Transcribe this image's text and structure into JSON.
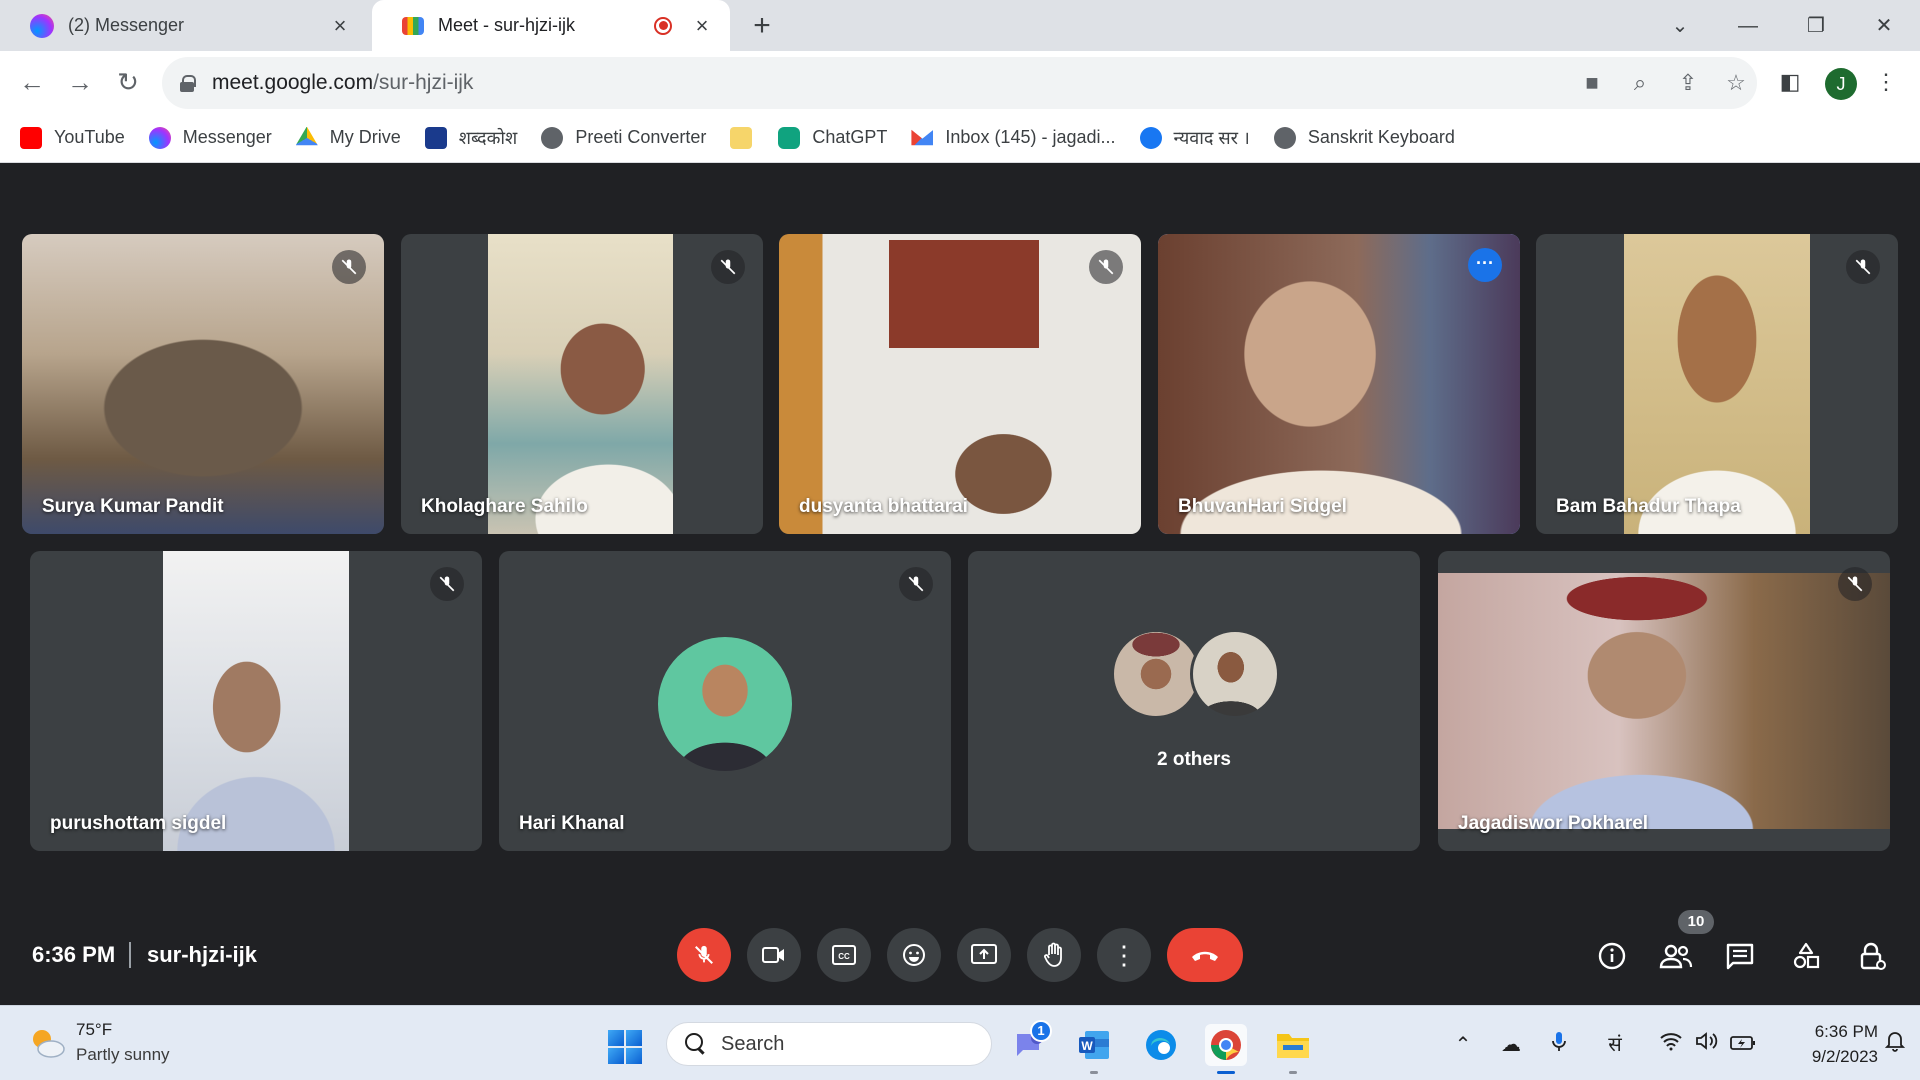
{
  "browser": {
    "tabs": [
      {
        "title": "(2) Messenger"
      },
      {
        "title": "Meet - sur-hjzi-ijk"
      }
    ],
    "url": {
      "host": "meet.google.com",
      "path": "/sur-hjzi-ijk"
    },
    "profile_initial": "J",
    "bookmarks": [
      {
        "label": "YouTube",
        "color": "#ff0000"
      },
      {
        "label": "Messenger",
        "color": "#a334fa"
      },
      {
        "label": "My Drive",
        "color": "#1fa463"
      },
      {
        "label": "शब्दकोश",
        "color": "#1a3a8c"
      },
      {
        "label": "Preeti Converter",
        "color": "#5f6368"
      },
      {
        "label": "",
        "color": "#f6d56a"
      },
      {
        "label": "ChatGPT",
        "color": "#10a37f"
      },
      {
        "label": "Inbox (145) - jagadi...",
        "color": "#ea4335"
      },
      {
        "label": "न्यवाद सर ।",
        "color": "#1877f2"
      },
      {
        "label": "Sanskrit Keyboard",
        "color": "#5f6368"
      }
    ]
  },
  "meet": {
    "participants": [
      {
        "name": "Surya Kumar Pandit",
        "muted": true
      },
      {
        "name": "Kholaghare Sahilo",
        "muted": true
      },
      {
        "name": "dusyanta bhattarai",
        "muted": true
      },
      {
        "name": "BhuvanHari Sidgel",
        "speaking": true
      },
      {
        "name": "Bam Bahadur Thapa",
        "muted": true
      },
      {
        "name": "purushottam sigdel",
        "muted": true
      },
      {
        "name": "Hari Khanal",
        "muted": true
      },
      {
        "name": "2 others"
      },
      {
        "name": "Jagadiswor Pokharel",
        "muted": true
      }
    ],
    "time": "6:36 PM",
    "meeting_code": "sur-hjzi-ijk",
    "participant_count": "10",
    "accent_red": "#ea4335",
    "speaking_outline": "#8ab4f8"
  },
  "taskbar": {
    "weather_temp": "75°F",
    "weather_condition": "Partly sunny",
    "search_label": "Search",
    "teams_badge": "1",
    "ime_label": "सं",
    "time": "6:36 PM",
    "date": "9/2/2023"
  }
}
